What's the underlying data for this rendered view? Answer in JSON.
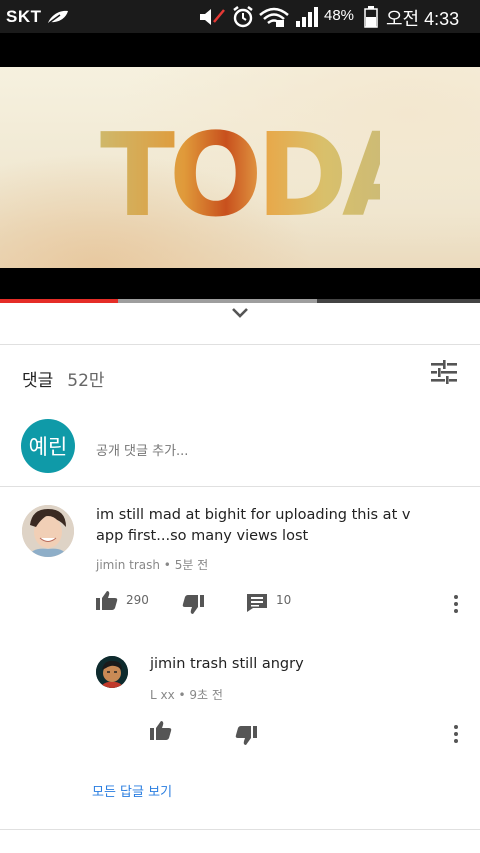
{
  "status_bar": {
    "carrier": "SKT",
    "battery": "48%",
    "time": "오전 4:33"
  },
  "video": {
    "title_text": "TODAY",
    "progress_played": 0.245,
    "progress_buffered_end": 0.66
  },
  "comments": {
    "label": "댓글",
    "count": "52만"
  },
  "composer": {
    "avatar_text": "예린",
    "placeholder": "공개 댓글 추가..."
  },
  "comment": {
    "text": "im still mad at bighit for uploading this at v app first...so many views lost",
    "author": "jimin trash",
    "time": "5분 전",
    "likes": "290",
    "replies": "10"
  },
  "reply": {
    "text": "jimin trash still angry",
    "author": "L xx",
    "time": "9초 전"
  },
  "view_replies": "모든 답글 보기",
  "colors": {
    "accent": "#e52d27",
    "avatar_bg": "#0f9aa8",
    "link": "#2a7ee0"
  }
}
